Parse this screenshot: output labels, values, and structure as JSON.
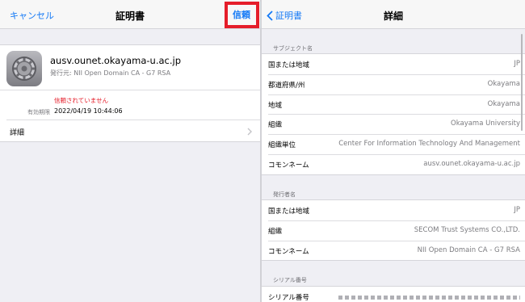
{
  "left": {
    "nav": {
      "cancel": "キャンセル",
      "title": "証明書",
      "trust": "信頼"
    },
    "cert": {
      "name": "ausv.ounet.okayama-u.ac.jp",
      "issuer": "発行元: NII Open Domain CA - G7 RSA",
      "status": "信頼されていません",
      "expiry_label": "有効期限",
      "expiry_value": "2022/04/19 10:44:06",
      "details_label": "詳細",
      "icon": "settings-gear-icon"
    },
    "colors": {
      "accent": "#1479f6",
      "warning": "#e51d2a",
      "highlight": "#e51d2a"
    }
  },
  "right": {
    "nav": {
      "back": "証明書",
      "title": "詳細"
    },
    "subject": {
      "header": "サブジェクト名",
      "rows": [
        {
          "label": "国または地域",
          "value": "JP"
        },
        {
          "label": "都道府県/州",
          "value": "Okayama"
        },
        {
          "label": "地域",
          "value": "Okayama"
        },
        {
          "label": "組織",
          "value": "Okayama University"
        },
        {
          "label": "組織単位",
          "value": "Center For Information Technology And Management"
        },
        {
          "label": "コモンネーム",
          "value": "ausv.ounet.okayama-u.ac.jp"
        }
      ]
    },
    "issuer": {
      "header": "発行者名",
      "rows": [
        {
          "label": "国または地域",
          "value": "JP"
        },
        {
          "label": "組織",
          "value": "SECOM Trust Systems CO.,LTD."
        },
        {
          "label": "コモンネーム",
          "value": "NII Open Domain CA - G7 RSA"
        }
      ]
    },
    "serial": {
      "header": "シリアル番号",
      "label": "シリアル番号"
    }
  }
}
